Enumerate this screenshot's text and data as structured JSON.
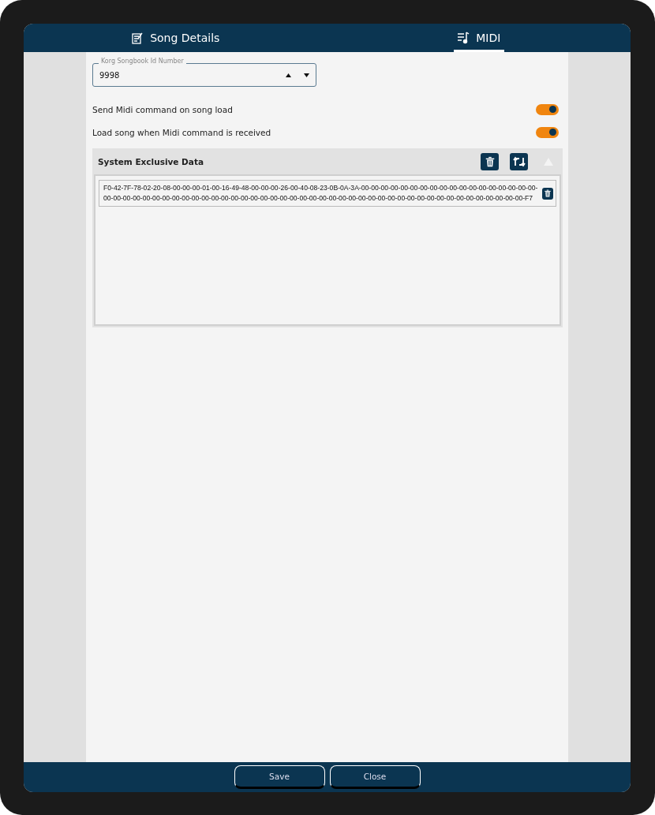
{
  "tabs": [
    {
      "label": "Song Details",
      "selected": false
    },
    {
      "label": "MIDI",
      "selected": true
    }
  ],
  "id_field": {
    "label": "Korg Songbook Id Number",
    "value": "9998"
  },
  "toggles": [
    {
      "label": "Send Midi command on song load",
      "on": true
    },
    {
      "label": "Load song when Midi command is received",
      "on": true
    }
  ],
  "sysex": {
    "title": "System Exclusive Data",
    "entries": [
      "F0-42-7F-78-02-20-08-00-00-00-01-00-16-49-48-00-00-00-26-00-40-08-23-0B-0A-3A-00-00-00-00-00-00-00-00-00-00-00-00-00-00-00-00-00-00-00-00-00-00-00-00-00-00-00-00-00-00-00-00-00-00-00-00-00-00-00-00-00-00-00-00-00-00-00-00-00-00-00-00-00-00-00-00-00-00-00-00-00-F7"
    ]
  },
  "buttons": [
    "Save",
    "Close"
  ]
}
